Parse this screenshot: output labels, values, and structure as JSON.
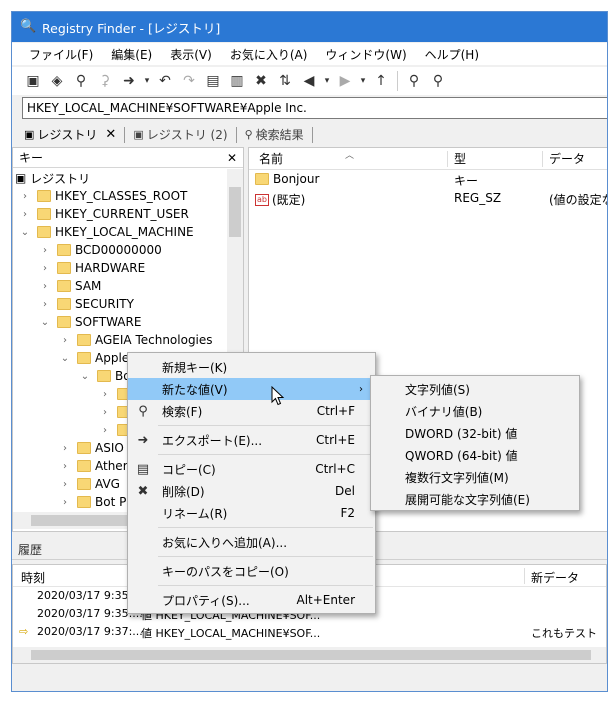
{
  "window": {
    "title": "Registry Finder - [レジストリ]"
  },
  "menu": [
    "ファイル(F)",
    "編集(E)",
    "表示(V)",
    "お気に入り(A)",
    "ウィンドウ(W)",
    "ヘルプ(H)"
  ],
  "address": "HKEY_LOCAL_MACHINE¥SOFTWARE¥Apple Inc.",
  "tabs": [
    {
      "label": "レジストリ",
      "active": true,
      "close": "✕"
    },
    {
      "label": "レジストリ (2)",
      "active": false
    },
    {
      "label": "検索結果",
      "active": false
    }
  ],
  "tree": {
    "header": "キー",
    "close": "✕",
    "nodes": [
      {
        "label": "レジストリ"
      },
      {
        "label": "HKEY_CLASSES_ROOT"
      },
      {
        "label": "HKEY_CURRENT_USER"
      },
      {
        "label": "HKEY_LOCAL_MACHINE"
      },
      {
        "label": "BCD00000000"
      },
      {
        "label": "HARDWARE"
      },
      {
        "label": "SAM"
      },
      {
        "label": "SECURITY"
      },
      {
        "label": "SOFTWARE"
      },
      {
        "label": "AGEIA Technologies"
      },
      {
        "label": "Apple"
      },
      {
        "label": "Bo"
      },
      {
        "label": ""
      },
      {
        "label": ""
      },
      {
        "label": ""
      },
      {
        "label": "ASIO"
      },
      {
        "label": "Athero"
      },
      {
        "label": "AVG"
      },
      {
        "label": "Bot Pr"
      }
    ]
  },
  "values": {
    "columns": [
      "名前",
      "型",
      "データ"
    ],
    "rows": [
      {
        "name": "Bonjour",
        "type": "キー",
        "data": ""
      },
      {
        "name": "(既定)",
        "type": "REG_SZ",
        "data": "(値の設定な"
      }
    ]
  },
  "history": {
    "title": "履歴",
    "columns": [
      "時刻",
      "新データ"
    ],
    "rows": [
      {
        "time": "2020/03/17 9:35:...",
        "desc": "",
        "new": ""
      },
      {
        "time": "2020/03/17 9:35:...",
        "desc": "値 HKEY_LOCAL_MACHINE¥SOF...",
        "new": ""
      },
      {
        "time": "2020/03/17 9:37:...",
        "desc": "値 HKEY_LOCAL_MACHINE¥SOF...",
        "new": "これもテスト"
      }
    ]
  },
  "context_menu": {
    "items": [
      {
        "label": "新規キー(K)",
        "key": "",
        "icon": ""
      },
      {
        "label": "新たな値(V)",
        "key": "",
        "icon": "",
        "submenu": true
      },
      {
        "label": "検索(F)",
        "key": "Ctrl+F",
        "icon": "search-icon"
      },
      {
        "label": "エクスポート(E)...",
        "key": "Ctrl+E",
        "icon": "export-icon"
      },
      {
        "label": "コピー(C)",
        "key": "Ctrl+C",
        "icon": "copy-icon"
      },
      {
        "label": "削除(D)",
        "key": "Del",
        "icon": "delete-icon"
      },
      {
        "label": "リネーム(R)",
        "key": "F2",
        "icon": ""
      },
      {
        "label": "お気に入りへ追加(A)...",
        "key": "",
        "icon": ""
      },
      {
        "label": "キーのパスをコピー(O)",
        "key": "",
        "icon": ""
      },
      {
        "label": "プロパティ(S)...",
        "key": "Alt+Enter",
        "icon": ""
      }
    ]
  },
  "submenu": {
    "items": [
      "文字列値(S)",
      "バイナリ値(B)",
      "DWORD (32-bit) 値",
      "QWORD (64-bit) 値",
      "複数行文字列値(M)",
      "展開可能な文字列値(E)"
    ]
  }
}
